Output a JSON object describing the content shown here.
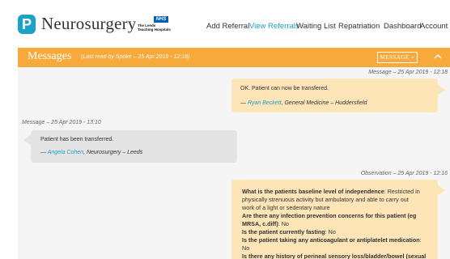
{
  "header": {
    "brand": "Neurosurgery",
    "nhs_badge": "NHS",
    "nhs_line1": "The Leeds",
    "nhs_line2": "Teaching Hospitals",
    "nav": [
      {
        "label": "Add Referral"
      },
      {
        "label": "View Referrals"
      },
      {
        "label": "Waiting List"
      },
      {
        "label": "Repatriation"
      },
      {
        "label": "Dashboard"
      },
      {
        "label": "Account"
      }
    ],
    "active_nav": "View Referrals",
    "caret": "▾"
  },
  "messages": {
    "title": "Messages",
    "last_read": "(Last read by Spoke – 25 Apr 2019 - 12:18)",
    "message_button": "MESSAGE +",
    "collapse_icon": "chevron-up-icon"
  },
  "thread": [
    {
      "side": "right",
      "meta": "Message – 25 Apr 2019 - 12:18",
      "text": "OK. Patient can now be transfered.",
      "dash": "— ",
      "author": "Ryan Beckett",
      "org": ", General Medicine – Huddersfield"
    },
    {
      "side": "left",
      "meta": "Message – 25 Apr 2019 - 13:10",
      "text": "Patient has been transferred.",
      "dash": "— ",
      "author": "Angela Cohen",
      "org": ", Neurosurgery – Leeds"
    }
  ],
  "observation": {
    "meta": "Observation – 25 Apr 2019 - 12:16",
    "lines": [
      {
        "q": "What is the patients baseline level of independence",
        "a": ": Restricted in"
      },
      {
        "q": "",
        "a": "physically strenuous activity but ambulatory and able to carry out"
      },
      {
        "q": "",
        "a": "work of a light or sedentary nature"
      },
      {
        "q": "Are there any infection prevention concerns for this patient (eg",
        "a": ""
      },
      {
        "q": "MRSA, c.diff)",
        "a": ": No"
      },
      {
        "q": "Is the patient currently fasting",
        "a": ": No"
      },
      {
        "q": "Is the patient taking any anticoagulant or antiplatelet medication",
        "a": ":"
      },
      {
        "q": "",
        "a": "No"
      },
      {
        "q": "Is there any history of perineal sensory loss/bladder/bowel (sexual",
        "a": ""
      }
    ]
  },
  "colors": {
    "accent": "#1aa3c7",
    "header_orange": "#f7a93b",
    "bubble_right": "#fde5b8",
    "bubble_left": "#e4e4e4"
  }
}
